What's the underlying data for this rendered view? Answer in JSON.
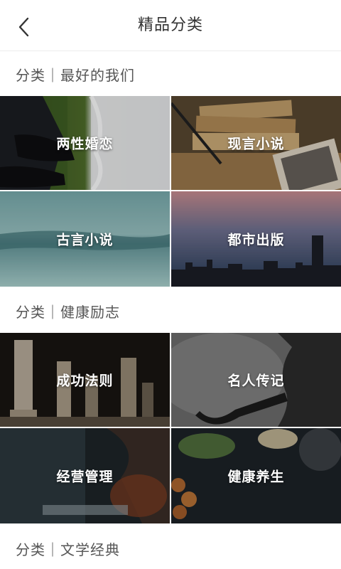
{
  "header": {
    "title": "精品分类",
    "back_icon": "chevron-left-icon"
  },
  "sections": [
    {
      "heading": "分类｜最好的我们",
      "tiles": [
        {
          "label": "两性婚恋"
        },
        {
          "label": "现言小说"
        },
        {
          "label": "古言小说"
        },
        {
          "label": "都市出版"
        }
      ]
    },
    {
      "heading": "分类｜健康励志",
      "tiles": [
        {
          "label": "成功法则"
        },
        {
          "label": "名人传记"
        },
        {
          "label": "经营管理"
        },
        {
          "label": "健康养生"
        }
      ]
    },
    {
      "heading": "分类｜文学经典"
    }
  ]
}
